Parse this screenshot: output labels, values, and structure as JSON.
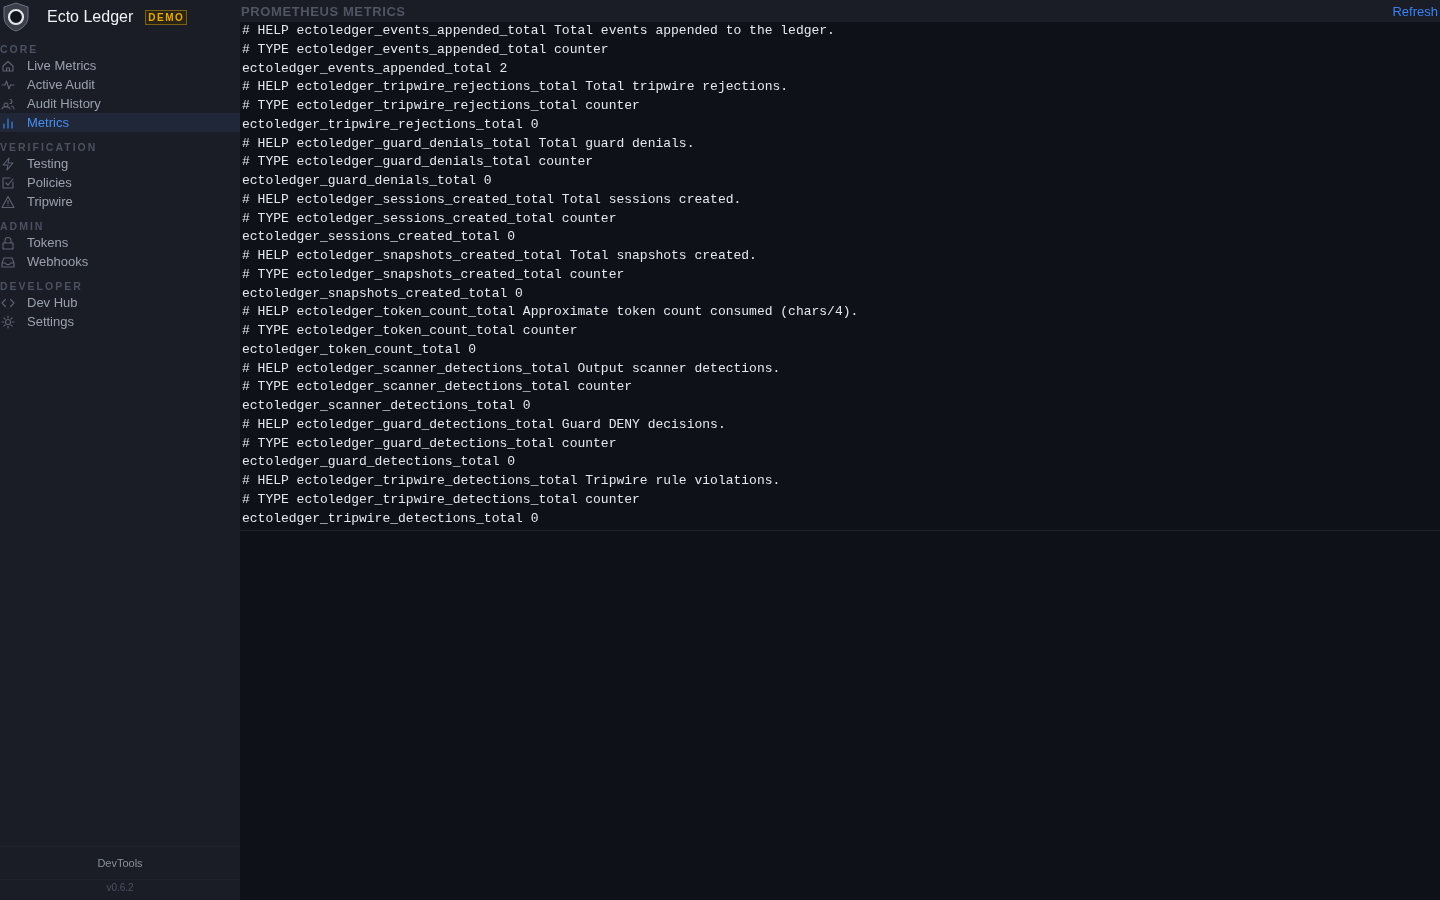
{
  "app": {
    "name": "Ecto Ledger",
    "badge": "DEMO"
  },
  "sidebar": {
    "groups": [
      {
        "title": "CORE",
        "items": [
          {
            "label": "Live Metrics",
            "selected": false
          },
          {
            "label": "Active Audit",
            "selected": false
          },
          {
            "label": "Audit History",
            "selected": false
          },
          {
            "label": "Metrics",
            "selected": true
          }
        ]
      },
      {
        "title": "VERIFICATION",
        "items": [
          {
            "label": "Testing",
            "selected": false
          },
          {
            "label": "Policies",
            "selected": false
          },
          {
            "label": "Tripwire",
            "selected": false
          }
        ]
      },
      {
        "title": "ADMIN",
        "items": [
          {
            "label": "Tokens",
            "selected": false
          },
          {
            "label": "Webhooks",
            "selected": false
          }
        ]
      },
      {
        "title": "DEVELOPER",
        "items": [
          {
            "label": "Dev Hub",
            "selected": false
          },
          {
            "label": "Settings",
            "selected": false
          }
        ]
      }
    ],
    "footer_button": "DevTools",
    "version": "v0.6.2"
  },
  "header": {
    "title": "PROMETHEUS METRICS",
    "action": "Refresh"
  },
  "metrics_lines": [
    "# HELP ectoledger_events_appended_total Total events appended to the ledger.",
    "# TYPE ectoledger_events_appended_total counter",
    "ectoledger_events_appended_total 2",
    "# HELP ectoledger_tripwire_rejections_total Total tripwire rejections.",
    "# TYPE ectoledger_tripwire_rejections_total counter",
    "ectoledger_tripwire_rejections_total 0",
    "# HELP ectoledger_guard_denials_total Total guard denials.",
    "# TYPE ectoledger_guard_denials_total counter",
    "ectoledger_guard_denials_total 0",
    "# HELP ectoledger_sessions_created_total Total sessions created.",
    "# TYPE ectoledger_sessions_created_total counter",
    "ectoledger_sessions_created_total 0",
    "# HELP ectoledger_snapshots_created_total Total snapshots created.",
    "# TYPE ectoledger_snapshots_created_total counter",
    "ectoledger_snapshots_created_total 0",
    "# HELP ectoledger_token_count_total Approximate token count consumed (chars/4).",
    "# TYPE ectoledger_token_count_total counter",
    "ectoledger_token_count_total 0",
    "# HELP ectoledger_scanner_detections_total Output scanner detections.",
    "# TYPE ectoledger_scanner_detections_total counter",
    "ectoledger_scanner_detections_total 0",
    "# HELP ectoledger_guard_detections_total Guard DENY decisions.",
    "# TYPE ectoledger_guard_detections_total counter",
    "ectoledger_guard_detections_total 0",
    "# HELP ectoledger_tripwire_detections_total Tripwire rule violations.",
    "# TYPE ectoledger_tripwire_detections_total counter",
    "ectoledger_tripwire_detections_total 0"
  ]
}
